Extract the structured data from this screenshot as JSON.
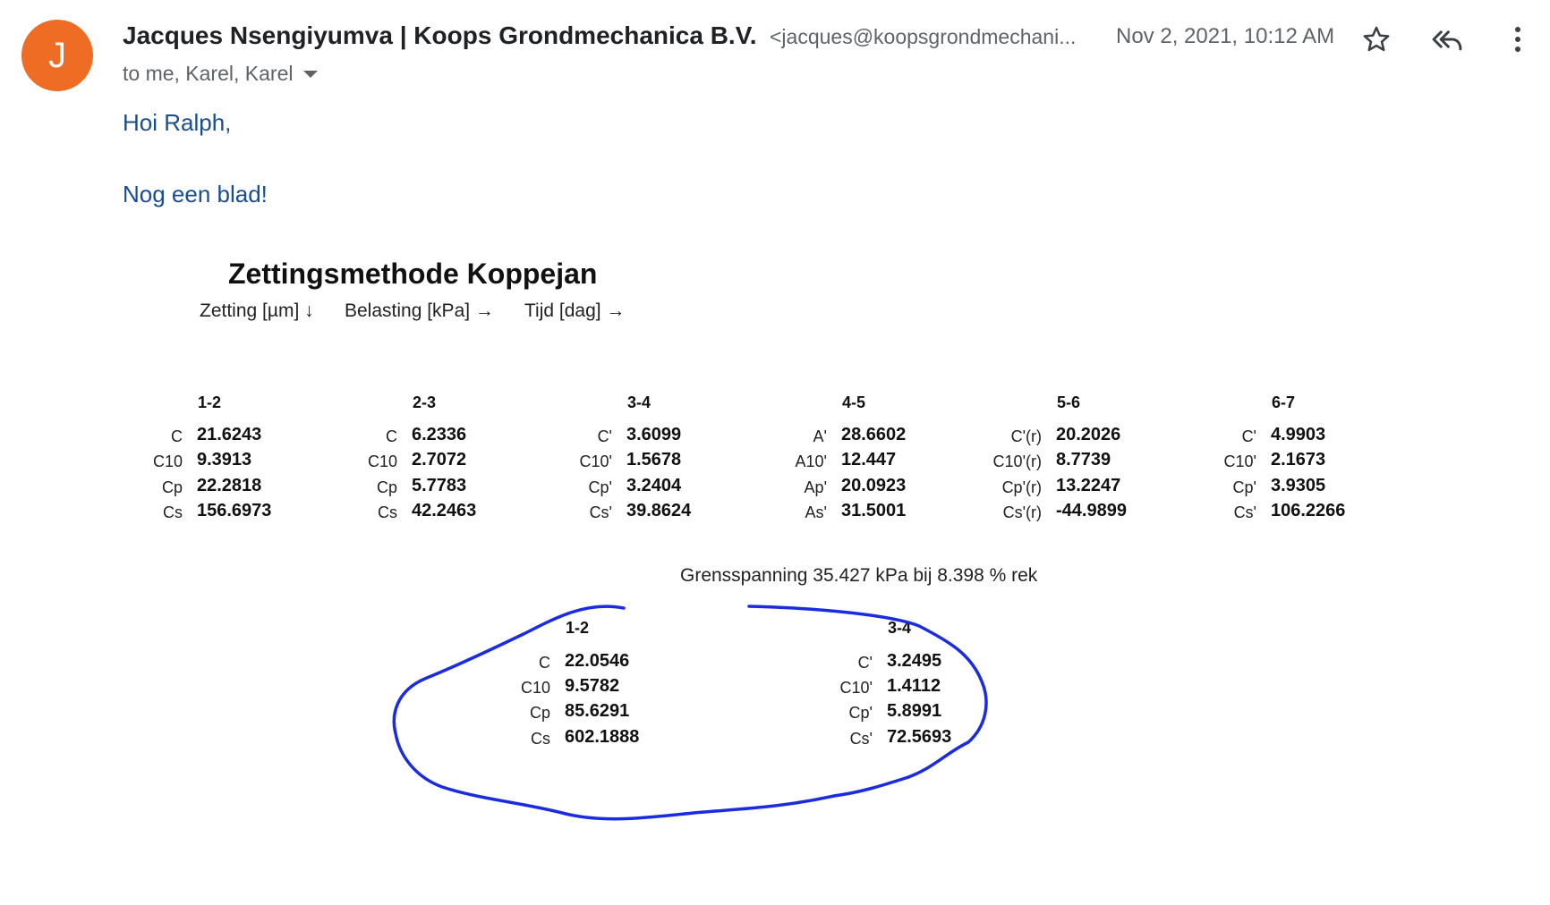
{
  "email": {
    "avatar_letter": "J",
    "avatar_color": "#ef6c24",
    "sender_name": "Jacques Nsengiyumva | Koops Grondmechanica B.V.",
    "sender_email": "<jacques@koopsgrondmechani...",
    "date": "Nov 2, 2021, 10:12 AM",
    "recipients": "to me, Karel, Karel",
    "icons": [
      "star-icon",
      "reply-all-icon",
      "more-vert-icon"
    ],
    "greeting": "Hoi Ralph,",
    "message": "Nog een blad!"
  },
  "sheet": {
    "title": "Zettingsmethode Koppejan",
    "axes": [
      "Zetting [µm] ↓",
      "Belasting [kPa] →",
      "Tijd [dag] →"
    ],
    "top_blocks": [
      {
        "header": "1-2",
        "rows": [
          {
            "label": "C",
            "value": "21.6243"
          },
          {
            "label": "C10",
            "value": "9.3913"
          },
          {
            "label": "Cp",
            "value": "22.2818"
          },
          {
            "label": "Cs",
            "value": "156.6973"
          }
        ]
      },
      {
        "header": "2-3",
        "rows": [
          {
            "label": "C",
            "value": "6.2336"
          },
          {
            "label": "C10",
            "value": "2.7072"
          },
          {
            "label": "Cp",
            "value": "5.7783"
          },
          {
            "label": "Cs",
            "value": "42.2463"
          }
        ]
      },
      {
        "header": "3-4",
        "rows": [
          {
            "label": "C'",
            "value": "3.6099"
          },
          {
            "label": "C10'",
            "value": "1.5678"
          },
          {
            "label": "Cp'",
            "value": "3.2404"
          },
          {
            "label": "Cs'",
            "value": "39.8624"
          }
        ]
      },
      {
        "header": "4-5",
        "rows": [
          {
            "label": "A'",
            "value": "28.6602"
          },
          {
            "label": "A10'",
            "value": "12.447"
          },
          {
            "label": "Ap'",
            "value": "20.0923"
          },
          {
            "label": "As'",
            "value": "31.5001"
          }
        ]
      },
      {
        "header": "5-6",
        "rows": [
          {
            "label": "C'(r)",
            "value": "20.2026"
          },
          {
            "label": "C10'(r)",
            "value": "8.7739"
          },
          {
            "label": "Cp'(r)",
            "value": "13.2247"
          },
          {
            "label": "Cs'(r)",
            "value": "-44.9899"
          }
        ]
      },
      {
        "header": "6-7",
        "rows": [
          {
            "label": "C'",
            "value": "4.9903"
          },
          {
            "label": "C10'",
            "value": "2.1673"
          },
          {
            "label": "Cp'",
            "value": "3.9305"
          },
          {
            "label": "Cs'",
            "value": "106.2266"
          }
        ]
      }
    ],
    "grensspanning": "Grensspanning 35.427 kPa bij 8.398 % rek",
    "bottom_blocks": [
      {
        "header": "1-2",
        "rows": [
          {
            "label": "C",
            "value": "22.0546"
          },
          {
            "label": "C10",
            "value": "9.5782"
          },
          {
            "label": "Cp",
            "value": "85.6291"
          },
          {
            "label": "Cs",
            "value": "602.1888"
          }
        ]
      },
      {
        "header": "3-4",
        "rows": [
          {
            "label": "C'",
            "value": "3.2495"
          },
          {
            "label": "C10'",
            "value": "1.4112"
          },
          {
            "label": "Cp'",
            "value": "5.8991"
          },
          {
            "label": "Cs'",
            "value": "72.5693"
          }
        ]
      }
    ],
    "ink_color": "#1a2be0"
  }
}
